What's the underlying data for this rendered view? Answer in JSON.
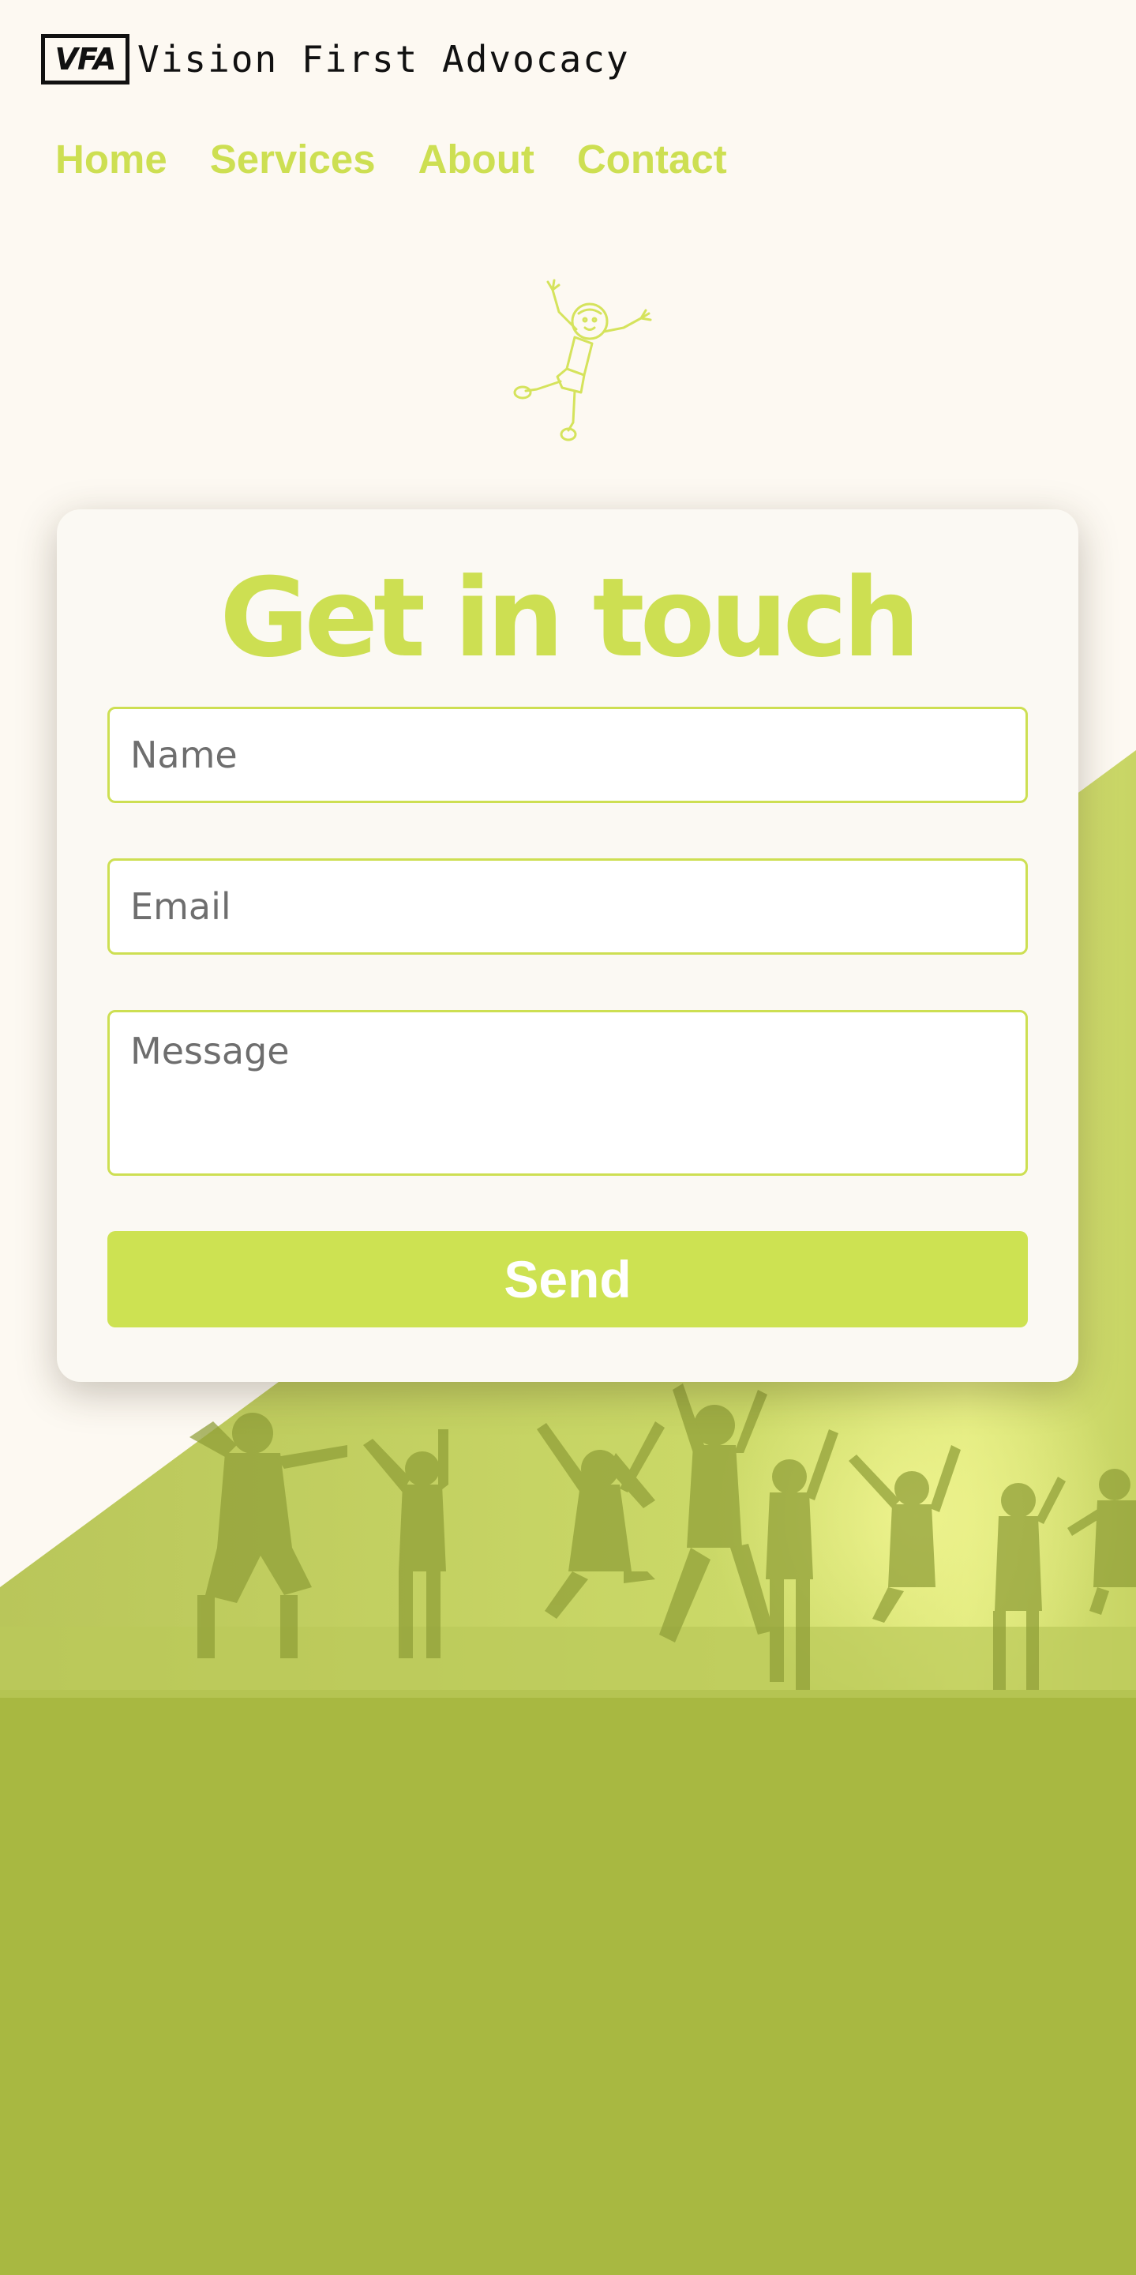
{
  "brand": {
    "logo_mark": "VFA",
    "name": "Vision First Advocacy"
  },
  "nav": {
    "items": [
      {
        "label": "Home"
      },
      {
        "label": "Services"
      },
      {
        "label": "About"
      },
      {
        "label": "Contact"
      }
    ]
  },
  "contact_form": {
    "title": "Get in touch",
    "name_placeholder": "Name",
    "email_placeholder": "Email",
    "message_placeholder": "Message",
    "send_label": "Send"
  },
  "colors": {
    "accent": "#cddf52",
    "background": "#fdf9f2",
    "hero_green": "#a8b841"
  },
  "icons": {
    "mascot": "jumping-stick-figure-icon"
  }
}
